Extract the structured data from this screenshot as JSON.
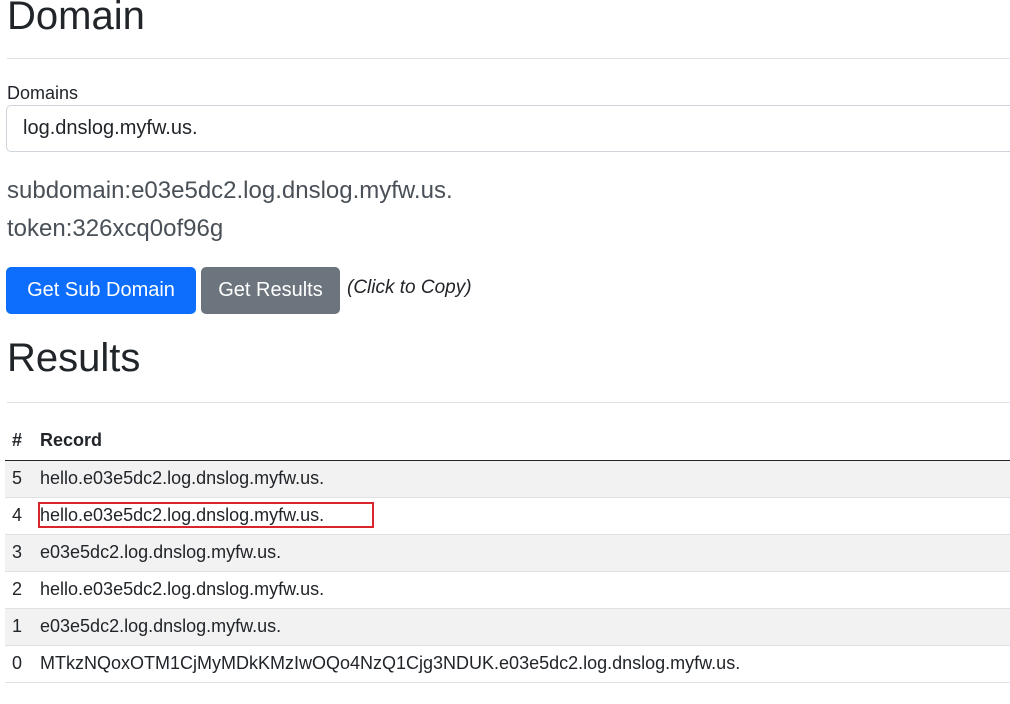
{
  "header": {
    "title": "Domain"
  },
  "form": {
    "label": "Domains",
    "domain_value": "log.dnslog.myfw.us."
  },
  "info": {
    "subdomain": "subdomain:e03e5dc2.log.dnslog.myfw.us.",
    "token": "token:326xcq0of96g"
  },
  "actions": {
    "get_sub_domain": "Get Sub Domain",
    "get_results": "Get Results",
    "copy_hint": "(Click to Copy)"
  },
  "results": {
    "title": "Results",
    "columns": [
      "#",
      "Record"
    ],
    "rows": [
      {
        "num": "5",
        "record": "hello.e03e5dc2.log.dnslog.myfw.us."
      },
      {
        "num": "4",
        "record": "hello.e03e5dc2.log.dnslog.myfw.us."
      },
      {
        "num": "3",
        "record": "e03e5dc2.log.dnslog.myfw.us."
      },
      {
        "num": "2",
        "record": "hello.e03e5dc2.log.dnslog.myfw.us."
      },
      {
        "num": "1",
        "record": "e03e5dc2.log.dnslog.myfw.us."
      },
      {
        "num": "0",
        "record": "MTkzNQoxOTM1CjMyMDkKMzIwOQo4NzQ1Cjg3NDUK.e03e5dc2.log.dnslog.myfw.us."
      }
    ],
    "highlighted_row": 1
  },
  "colors": {
    "primary": "#0d6efd",
    "secondary": "#6c757d",
    "highlight": "#d9262c"
  }
}
